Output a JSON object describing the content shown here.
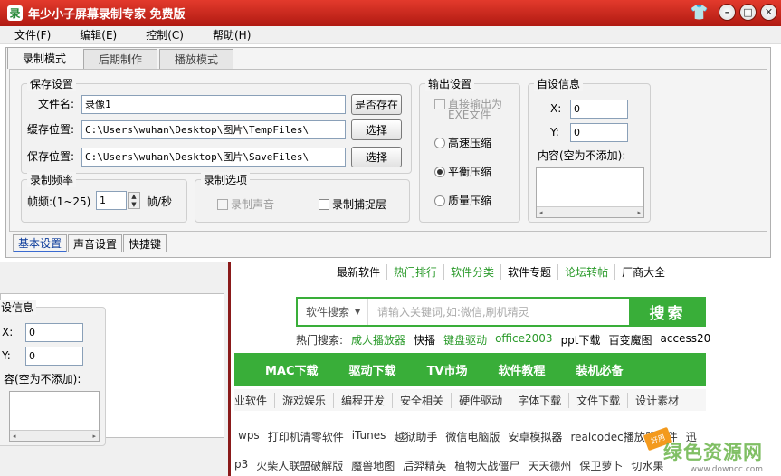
{
  "window": {
    "title": "年少小子屏幕录制专家 免费版"
  },
  "menu": [
    "文件(F)",
    "编辑(E)",
    "控制(C)",
    "帮助(H)"
  ],
  "tabs": [
    "录制模式",
    "后期制作",
    "播放模式"
  ],
  "save_settings": {
    "group_label": "保存设置",
    "filename_label": "文件名:",
    "filename_value": "录像1",
    "exists_button": "是否存在",
    "cache_label": "缓存位置:",
    "cache_value": "C:\\Users\\wuhan\\Desktop\\图片\\TempFiles\\",
    "cache_button": "选择",
    "save_label": "保存位置:",
    "save_value": "C:\\Users\\wuhan\\Desktop\\图片\\SaveFiles\\",
    "save_button": "选择"
  },
  "frame_rate": {
    "group_label": "录制频率",
    "label": "帧频:(1~25)",
    "value": "1",
    "unit": "帧/秒"
  },
  "record_options": {
    "group_label": "录制选项",
    "sound": "录制声音",
    "layers": "录制捕捉层"
  },
  "output_settings": {
    "group_label": "输出设置",
    "direct_exe": "直接输出为EXE文件",
    "high": "高速压缩",
    "balance": "平衡压缩",
    "quality": "质量压缩"
  },
  "custom_info": {
    "group_label": "自设信息",
    "x_label": "X:",
    "x_value": "0",
    "y_label": "Y:",
    "y_value": "0",
    "content_label": "内容(空为不添加):"
  },
  "subtabs": [
    "基本设置",
    "声音设置",
    "快捷键"
  ],
  "bg_panel": {
    "group_label": "设信息",
    "x_label": "X:",
    "x_value": "0",
    "y_label": "Y:",
    "y_value": "0",
    "content_label": "容(空为不添加):"
  },
  "web": {
    "top_links": [
      "最新软件",
      "热门排行",
      "软件分类",
      "软件专题",
      "论坛转帖",
      "厂商大全"
    ],
    "search_category": "软件搜索",
    "search_placeholder": "请输入关键词,如:微信,刷机精灵",
    "search_button": "搜索",
    "hot_label": "热门搜索:",
    "hot_items": [
      "成人播放器",
      "快播",
      "键盘驱动",
      "office2003",
      "ppt下载",
      "百变魔图",
      "access20"
    ],
    "green_nav": [
      "MAC下载",
      "驱动下载",
      "TV市场",
      "软件教程",
      "装机必备"
    ],
    "categories": [
      "业软件",
      "游戏娱乐",
      "编程开发",
      "安全相关",
      "硬件驱动",
      "字体下载",
      "文件下载",
      "设计素材"
    ],
    "tags_row1": [
      "wps",
      "打印机清零软件",
      "iTunes",
      "越狱助手",
      "微信电脑版",
      "安卓模拟器",
      "realcodec播放器插件",
      "迅"
    ],
    "tags_row2": [
      "p3",
      "火柴人联盟破解版",
      "魔兽地图",
      "后羿精英",
      "植物大战僵尸",
      "天天德州",
      "保卫萝卜",
      "切水果"
    ],
    "watermark_main": "绿色资源网",
    "watermark_url": "www.downcc.com",
    "watermark_badge": "好用"
  }
}
